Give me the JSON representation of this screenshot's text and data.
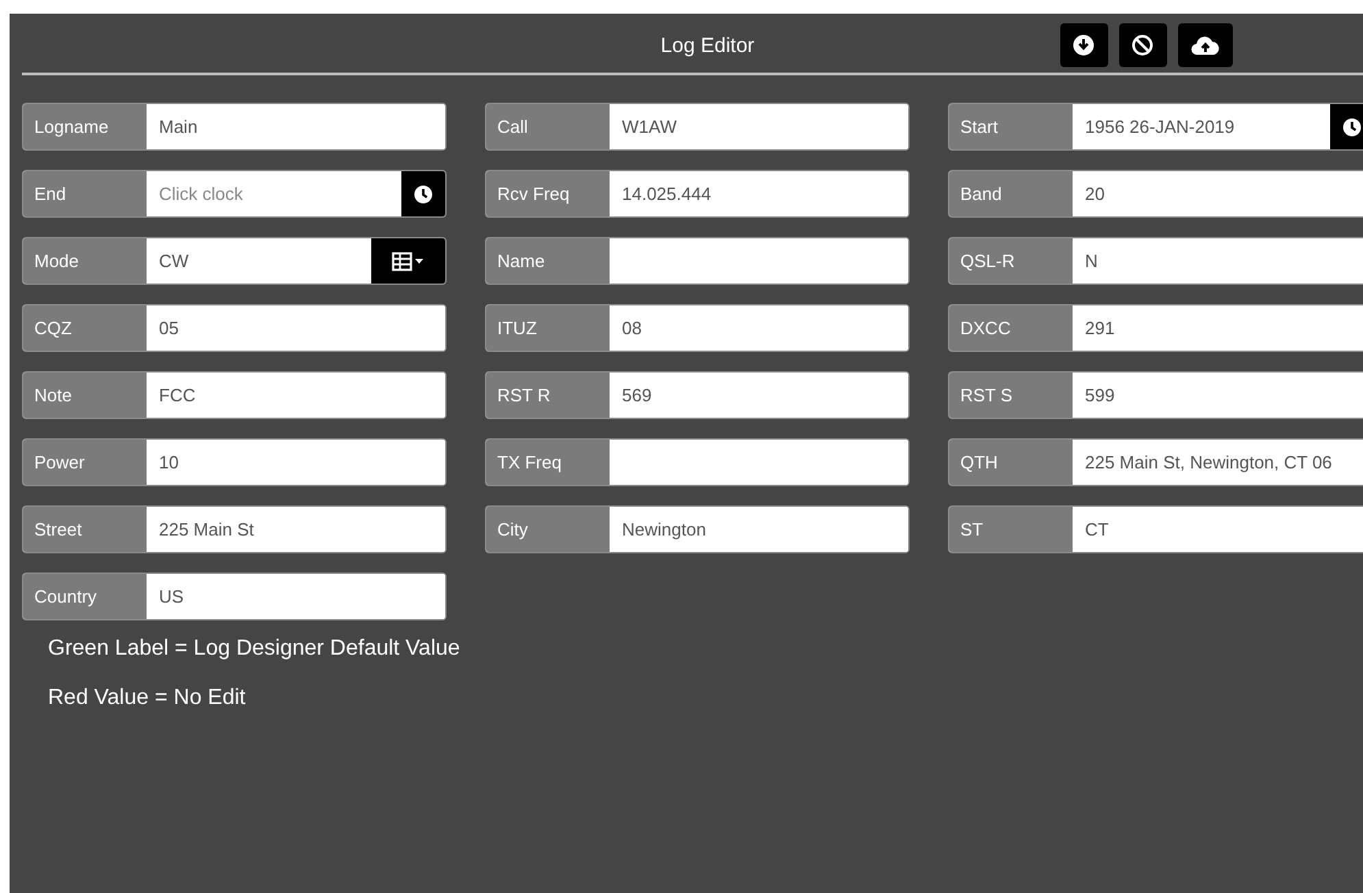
{
  "window": {
    "title": "Log Editor"
  },
  "toolbar": [
    {
      "kind": "download"
    },
    {
      "kind": "cancel"
    },
    {
      "kind": "upload"
    }
  ],
  "columns": [
    {
      "fields": [
        {
          "label": "Logname",
          "value": "Main",
          "kind": "text"
        },
        {
          "label": "End",
          "placeholder": "Click clock",
          "kind": "clock"
        },
        {
          "label": "Mode",
          "value": "CW",
          "kind": "dropdown"
        },
        {
          "label": "CQZ",
          "value": "05",
          "kind": "text"
        },
        {
          "label": "Note",
          "value": "FCC",
          "kind": "text"
        },
        {
          "label": "Power",
          "value": "10",
          "kind": "text"
        },
        {
          "label": "Street",
          "value": "225 Main St",
          "kind": "text"
        },
        {
          "label": "Country",
          "value": "US",
          "kind": "text"
        }
      ]
    },
    {
      "fields": [
        {
          "label": "Call",
          "value": "W1AW",
          "kind": "text"
        },
        {
          "label": "Rcv Freq",
          "value": "14.025.444",
          "kind": "text"
        },
        {
          "label": "Name",
          "kind": "text"
        },
        {
          "label": "ITUZ",
          "value": "08",
          "kind": "text"
        },
        {
          "label": "RST R",
          "value": "569",
          "kind": "text"
        },
        {
          "label": "TX Freq",
          "kind": "text"
        },
        {
          "label": "City",
          "value": "Newington",
          "kind": "text"
        }
      ]
    },
    {
      "fields": [
        {
          "label": "Start",
          "value": "1956 26-JAN-2019",
          "kind": "clock"
        },
        {
          "label": "Band",
          "value": "20",
          "kind": "text"
        },
        {
          "label": "QSL-R",
          "value": "N",
          "kind": "text"
        },
        {
          "label": "DXCC",
          "value": "291",
          "kind": "text"
        },
        {
          "label": "RST S",
          "value": "599",
          "kind": "text"
        },
        {
          "label": "QTH",
          "value": "225 Main St, Newington, CT 06",
          "kind": "text"
        },
        {
          "label": "ST",
          "value": "CT",
          "kind": "text"
        }
      ]
    }
  ],
  "legend": [
    "Green Label = Log Designer Default Value",
    "Red Value = No Edit"
  ]
}
